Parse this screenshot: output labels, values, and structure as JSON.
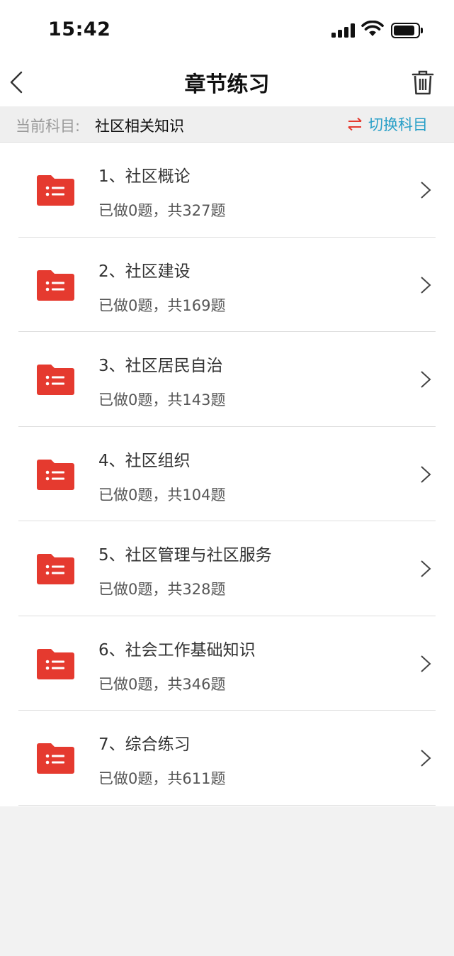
{
  "status_bar": {
    "time": "15:42"
  },
  "nav": {
    "title": "章节练习",
    "back_icon": "chevron-left-icon",
    "trash_icon": "trash-icon"
  },
  "subject": {
    "label": "当前科目:",
    "value": "社区相关知识",
    "switch_label": "切换科目",
    "switch_icon": "swap-arrows-icon"
  },
  "colors": {
    "accent_red": "#e53a2f",
    "accent_blue": "#2aa0c8",
    "background": "#f2f2f2"
  },
  "chapters": [
    {
      "title": "1、社区概论",
      "progress": "已做0题，共327题"
    },
    {
      "title": "2、社区建设",
      "progress": "已做0题，共169题"
    },
    {
      "title": "3、社区居民自治",
      "progress": "已做0题，共143题"
    },
    {
      "title": "4、社区组织",
      "progress": "已做0题，共104题"
    },
    {
      "title": "5、社区管理与社区服务",
      "progress": "已做0题，共328题"
    },
    {
      "title": "6、社会工作基础知识",
      "progress": "已做0题，共346题"
    },
    {
      "title": "7、综合练习",
      "progress": "已做0题，共611题"
    }
  ]
}
